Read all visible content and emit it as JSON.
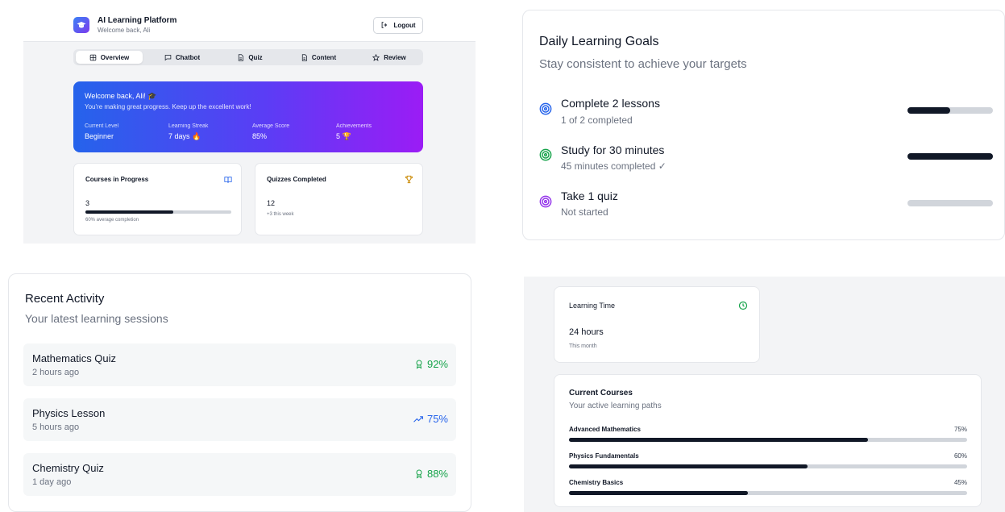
{
  "header": {
    "app_title": "AI Learning Platform",
    "welcome_sub": "Welcome back, Ali",
    "logout_label": "Logout",
    "logout_icon": "log-out-icon"
  },
  "tabs": [
    {
      "label": "Overview",
      "icon": "dashboard-icon",
      "active": true
    },
    {
      "label": "Chatbot",
      "icon": "chat-icon",
      "active": false
    },
    {
      "label": "Quiz",
      "icon": "document-icon",
      "active": false
    },
    {
      "label": "Content",
      "icon": "document-icon",
      "active": false
    },
    {
      "label": "Review",
      "icon": "star-icon",
      "active": false
    }
  ],
  "hero": {
    "welcome": "Welcome back, Ali! 🎓",
    "subtitle": "You're making great progress. Keep up the excellent work!",
    "stats": [
      {
        "label": "Current Level",
        "value": "Beginner"
      },
      {
        "label": "Learning Streak",
        "value": "7 days 🔥"
      },
      {
        "label": "Average Score",
        "value": "85%"
      },
      {
        "label": "Achievements",
        "value": "5 🏆"
      }
    ]
  },
  "cards": {
    "courses": {
      "title": "Courses in Progress",
      "value": "3",
      "note": "60% average completion",
      "progress": 0.6
    },
    "quizzes": {
      "title": "Quizzes Completed",
      "value": "12",
      "note": "+3 this week"
    }
  },
  "goals": {
    "title": "Daily Learning Goals",
    "subtitle": "Stay consistent to achieve your targets",
    "items": [
      {
        "title": "Complete 2 lessons",
        "status": "1 of 2 completed",
        "progress": 0.5,
        "color": "#2563eb"
      },
      {
        "title": "Study for 30 minutes",
        "status": "45 minutes completed ✓",
        "progress": 1.0,
        "color": "#16a34a"
      },
      {
        "title": "Take 1 quiz",
        "status": "Not started",
        "progress": 0.0,
        "color": "#9333ea"
      }
    ]
  },
  "activity": {
    "title": "Recent Activity",
    "subtitle": "Your latest learning sessions",
    "items": [
      {
        "title": "Mathematics Quiz",
        "time": "2 hours ago",
        "score": "92%",
        "icon": "award-icon",
        "color": "#16a34a"
      },
      {
        "title": "Physics Lesson",
        "time": "5 hours ago",
        "score": "75%",
        "icon": "trending-up-icon",
        "color": "#2563eb"
      },
      {
        "title": "Chemistry Quiz",
        "time": "1 day ago",
        "score": "88%",
        "icon": "award-icon",
        "color": "#16a34a"
      }
    ]
  },
  "learning_time": {
    "title": "Learning Time",
    "value": "24 hours",
    "note": "This month",
    "icon": "clock-icon"
  },
  "courses": {
    "title": "Current Courses",
    "subtitle": "Your active learning paths",
    "items": [
      {
        "name": "Advanced Mathematics",
        "percent": "75%",
        "progress": 0.75
      },
      {
        "name": "Physics Fundamentals",
        "percent": "60%",
        "progress": 0.6
      },
      {
        "name": "Chemistry Basics",
        "percent": "45%",
        "progress": 0.45
      }
    ]
  }
}
